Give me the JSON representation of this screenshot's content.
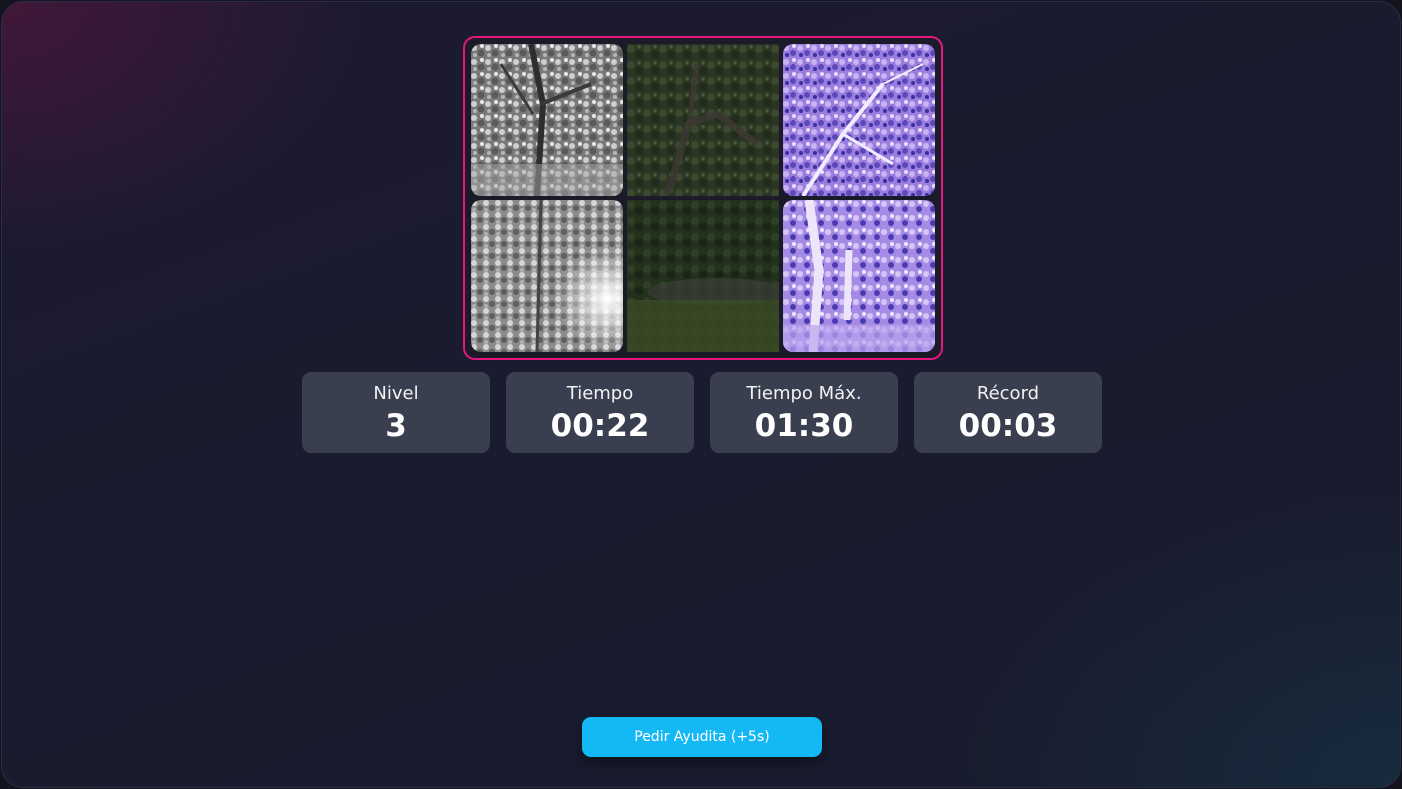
{
  "puzzle": {
    "accent_color": "#e5177f",
    "tiles": [
      {
        "filter": "grayscale",
        "color": "#8a8a8a"
      },
      {
        "filter": "dark",
        "color": "#2f3a25"
      },
      {
        "filter": "inverted",
        "color": "#9a7ee0"
      },
      {
        "filter": "grayscale",
        "color": "#9a9a9a"
      },
      {
        "filter": "dark",
        "color": "#263020"
      },
      {
        "filter": "inverted",
        "color": "#a68ce6"
      }
    ]
  },
  "stats": {
    "level": {
      "label": "Nivel",
      "value": "3"
    },
    "time": {
      "label": "Tiempo",
      "value": "00:22"
    },
    "max_time": {
      "label": "Tiempo Máx.",
      "value": "01:30"
    },
    "record": {
      "label": "Récord",
      "value": "00:03"
    }
  },
  "help_button": {
    "label": "Pedir Ayudita (+5s)",
    "color": "#14b8f5"
  }
}
